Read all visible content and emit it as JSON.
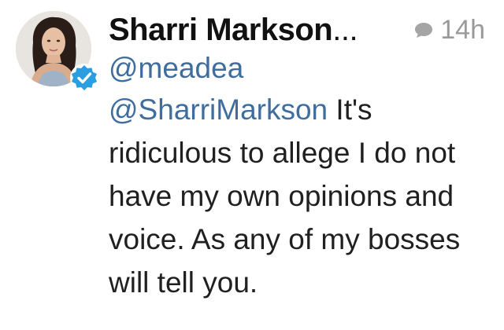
{
  "tweet": {
    "display_name": "Sharri Markson",
    "name_truncation": "...",
    "timestamp": "14h",
    "handle": "@meadea",
    "reply_mention": "@SharriMarkson",
    "text": " It's ridiculous to allege I do not have my own opinions and voice. As any of my bosses will tell you.",
    "verified": true
  },
  "icons": {
    "verified": "verified-check-icon",
    "reply": "speech-bubble-icon"
  },
  "colors": {
    "link": "#3f6e9e",
    "name": "#111111",
    "meta": "#9a9a9a",
    "verified_badge": "#2a9ee0",
    "background": "#ffffff"
  }
}
